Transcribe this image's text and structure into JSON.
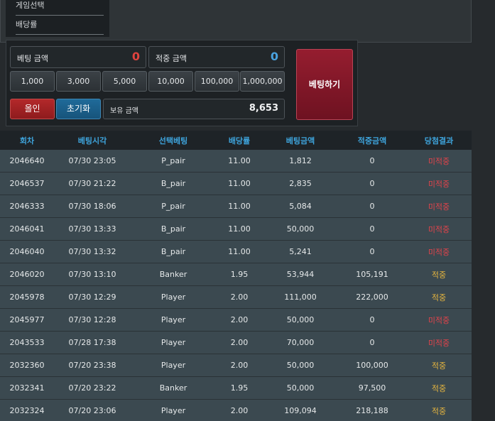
{
  "menu": {
    "game_select": "게임선택",
    "odds": "배당률"
  },
  "bet_panel": {
    "bet_amount_label": "베팅 금액",
    "bet_amount_value": "0",
    "hit_amount_label": "적중 금액",
    "hit_amount_value": "0",
    "chips": [
      "1,000",
      "3,000",
      "5,000",
      "10,000",
      "100,000",
      "1,000,000"
    ],
    "all_in": "올인",
    "reset": "초기화",
    "owned_label": "보유 금액",
    "owned_value": "8,653",
    "bet_button": "베팅하기"
  },
  "table": {
    "headers": [
      "회차",
      "베팅시각",
      "선택베팅",
      "배당률",
      "베팅금액",
      "적중금액",
      "당첨결과"
    ],
    "rows": [
      [
        "2046640",
        "07/30 23:05",
        "P_pair",
        "11.00",
        "1,812",
        "0",
        "미적중"
      ],
      [
        "2046537",
        "07/30 21:22",
        "B_pair",
        "11.00",
        "2,835",
        "0",
        "미적중"
      ],
      [
        "2046333",
        "07/30 18:06",
        "P_pair",
        "11.00",
        "5,084",
        "0",
        "미적중"
      ],
      [
        "2046041",
        "07/30 13:33",
        "B_pair",
        "11.00",
        "50,000",
        "0",
        "미적중"
      ],
      [
        "2046040",
        "07/30 13:32",
        "B_pair",
        "11.00",
        "5,241",
        "0",
        "미적중"
      ],
      [
        "2046020",
        "07/30 13:10",
        "Banker",
        "1.95",
        "53,944",
        "105,191",
        "적중"
      ],
      [
        "2045978",
        "07/30 12:29",
        "Player",
        "2.00",
        "111,000",
        "222,000",
        "적중"
      ],
      [
        "2045977",
        "07/30 12:28",
        "Player",
        "2.00",
        "50,000",
        "0",
        "미적중"
      ],
      [
        "2043533",
        "07/28 17:38",
        "Player",
        "2.00",
        "70,000",
        "0",
        "미적중"
      ],
      [
        "2032360",
        "07/20 23:38",
        "Player",
        "2.00",
        "50,000",
        "100,000",
        "적중"
      ],
      [
        "2032341",
        "07/20 23:22",
        "Banker",
        "1.95",
        "50,000",
        "97,500",
        "적중"
      ],
      [
        "2032324",
        "07/20 23:06",
        "Player",
        "2.00",
        "109,094",
        "218,188",
        "적중"
      ]
    ]
  },
  "colors": {
    "lose": "#e2434b",
    "win": "#e6b53f",
    "header": "#3ea4dc"
  }
}
